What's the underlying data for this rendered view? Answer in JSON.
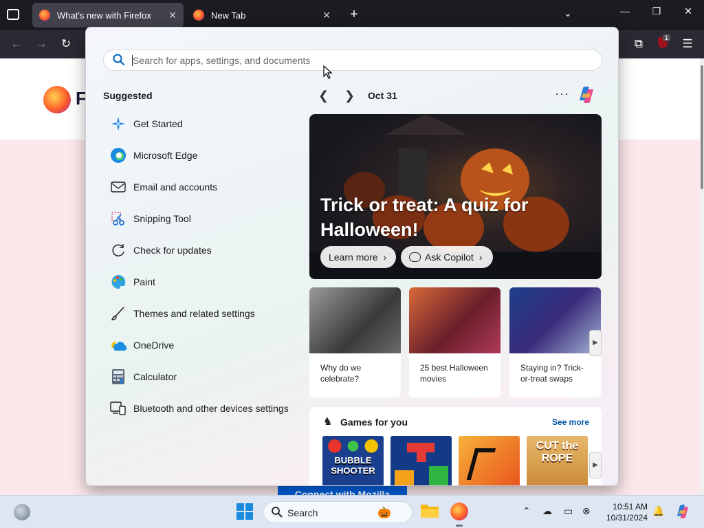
{
  "browser": {
    "tabs": [
      {
        "label": "What's new with Firefox",
        "active": true
      },
      {
        "label": "New Tab",
        "active": false
      }
    ],
    "ublock_badge": "1",
    "page": {
      "brand_letter": "F",
      "connect_button": "Connect with Mozilla"
    }
  },
  "start_menu": {
    "search": {
      "placeholder": "Search for apps, settings, and documents",
      "value": ""
    },
    "suggested_title": "Suggested",
    "suggested": [
      {
        "label": "Get Started",
        "icon": "get-started-icon"
      },
      {
        "label": "Microsoft Edge",
        "icon": "edge-icon"
      },
      {
        "label": "Email and accounts",
        "icon": "mail-icon"
      },
      {
        "label": "Snipping Tool",
        "icon": "scissors-icon"
      },
      {
        "label": "Check for updates",
        "icon": "refresh-icon"
      },
      {
        "label": "Paint",
        "icon": "palette-icon"
      },
      {
        "label": "Themes and related settings",
        "icon": "brush-icon"
      },
      {
        "label": "OneDrive",
        "icon": "cloud-icon"
      },
      {
        "label": "Calculator",
        "icon": "calculator-icon"
      },
      {
        "label": "Bluetooth and other devices settings",
        "icon": "devices-icon"
      }
    ],
    "feed": {
      "date": "Oct 31",
      "hero": {
        "title": "Trick or treat: A quiz for Halloween!",
        "learn_more": "Learn more",
        "ask_copilot": "Ask Copilot"
      },
      "cards": [
        {
          "caption": "Why do we celebrate?"
        },
        {
          "caption": "25 best Halloween movies"
        },
        {
          "caption": "Staying in? Trick-or-treat swaps"
        }
      ],
      "games": {
        "title": "Games for you",
        "see_more": "See more",
        "items": [
          {
            "label": "BUBBLE SHOOTER",
            "color": "#1b3f8f"
          },
          {
            "label": "",
            "color": "#123a86"
          },
          {
            "label": "",
            "color": "#f3a21b"
          },
          {
            "label": "CUT the ROPE",
            "color": "#e8b86a"
          }
        ]
      }
    }
  },
  "taskbar": {
    "search_label": "Search",
    "time": "10:51 AM",
    "date": "10/31/2024"
  },
  "colors": {
    "accent": "#0060df",
    "taskbar": "#dde6f2",
    "link": "#0054a6"
  }
}
